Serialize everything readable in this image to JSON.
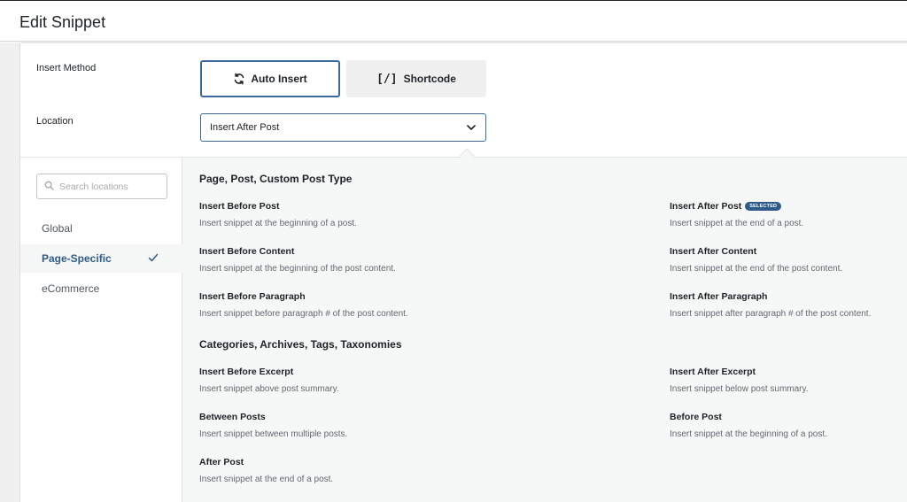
{
  "header": {
    "title": "Edit Snippet"
  },
  "insert_method": {
    "label": "Insert Method",
    "auto_insert_label": "Auto Insert",
    "shortcode_label": "Shortcode",
    "shortcode_symbol": "[/]"
  },
  "location": {
    "label": "Location",
    "selected": "Insert After Post"
  },
  "sidebar": {
    "search_placeholder": "Search locations",
    "items": [
      {
        "label": "Global"
      },
      {
        "label": "Page-Specific",
        "active": true
      },
      {
        "label": "eCommerce"
      }
    ]
  },
  "sections": [
    {
      "title": "Page, Post, Custom Post Type",
      "options": [
        {
          "name": "Insert Before Post",
          "desc": "Insert snippet at the beginning of a post."
        },
        {
          "name": "Insert After Post",
          "desc": "Insert snippet at the end of a post.",
          "badge": "SELECTED"
        },
        {
          "name": "Insert Before Content",
          "desc": "Insert snippet at the beginning of the post content."
        },
        {
          "name": "Insert After Content",
          "desc": "Insert snippet at the end of the post content."
        },
        {
          "name": "Insert Before Paragraph",
          "desc": "Insert snippet before paragraph # of the post content."
        },
        {
          "name": "Insert After Paragraph",
          "desc": "Insert snippet after paragraph # of the post content."
        }
      ]
    },
    {
      "title": "Categories, Archives, Tags, Taxonomies",
      "options": [
        {
          "name": "Insert Before Excerpt",
          "desc": "Insert snippet above post summary."
        },
        {
          "name": "Insert After Excerpt",
          "desc": "Insert snippet below post summary."
        },
        {
          "name": "Between Posts",
          "desc": "Insert snippet between multiple posts."
        },
        {
          "name": "Before Post",
          "desc": "Insert snippet at the beginning of a post."
        },
        {
          "name": "After Post",
          "desc": "Insert snippet at the end of a post."
        }
      ]
    }
  ],
  "colors": {
    "accent": "#2e5b8a",
    "border_active": "#3a6a9c"
  }
}
